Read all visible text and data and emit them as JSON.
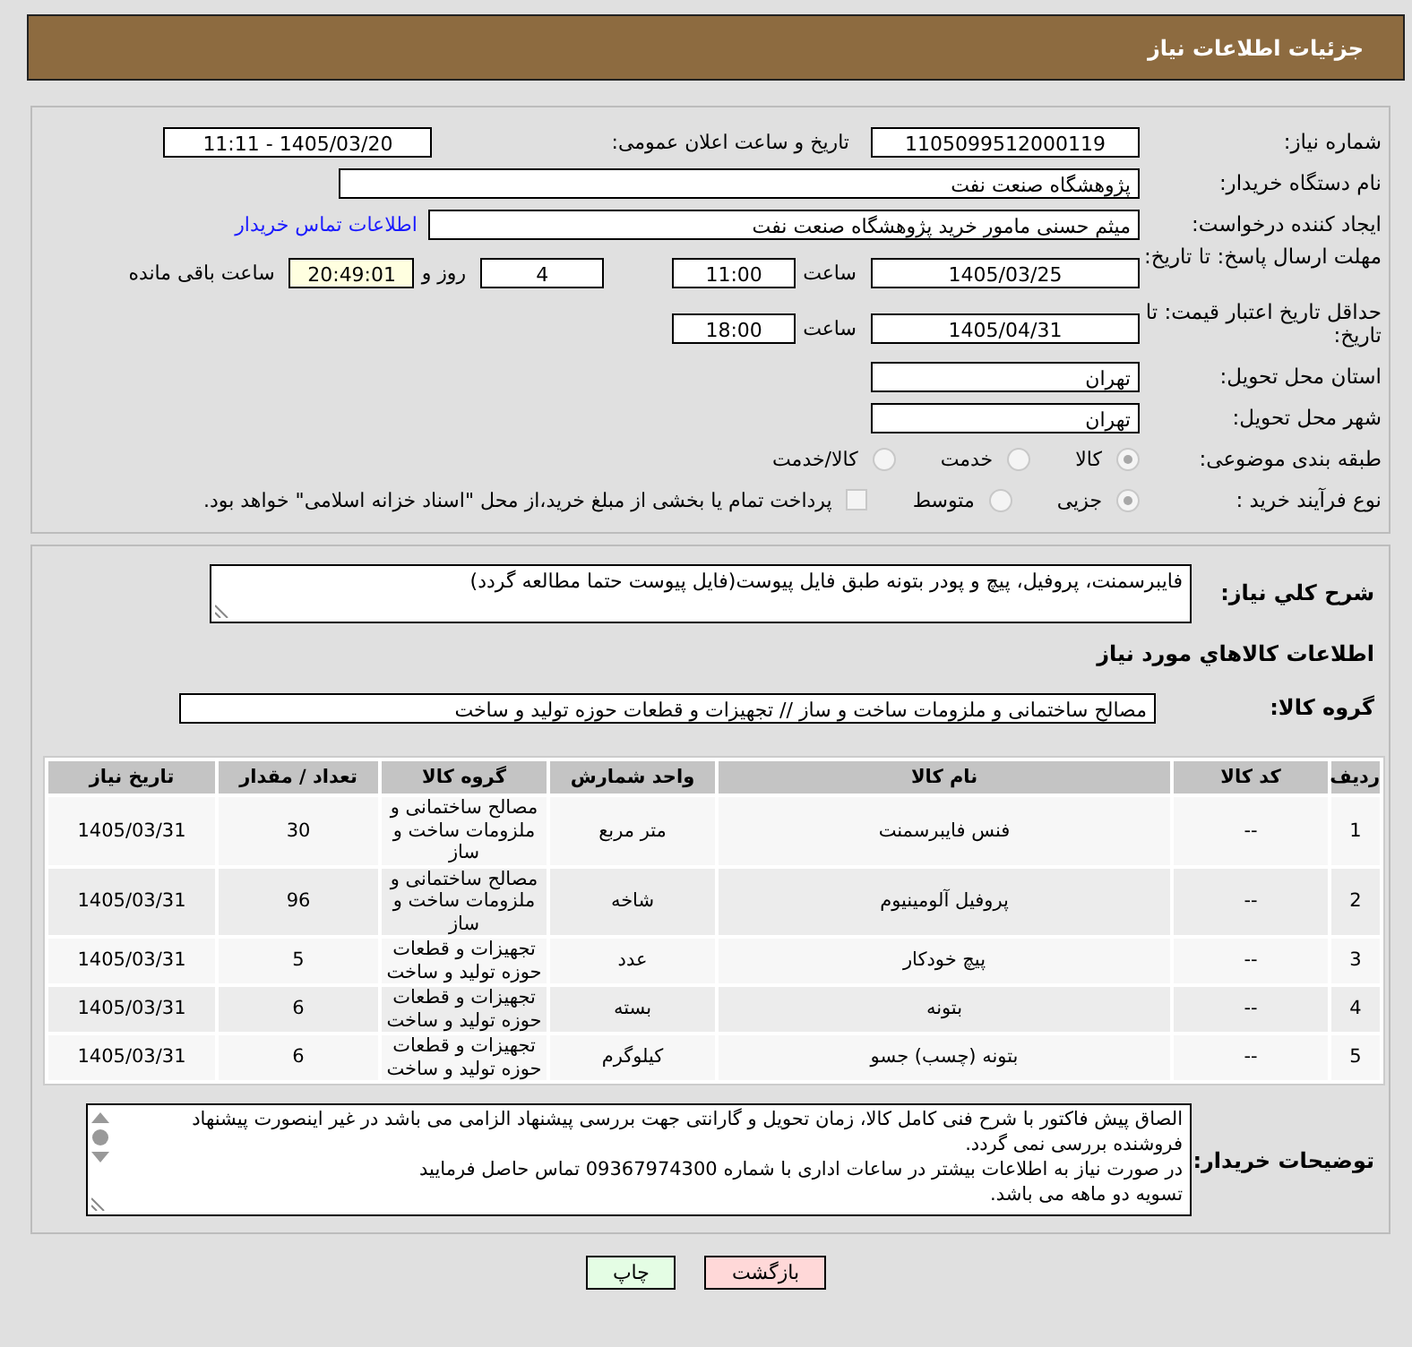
{
  "header": {
    "title": "جزئیات اطلاعات نیاز"
  },
  "form": {
    "need_number": {
      "label": "شماره نیاز:",
      "value": "1105099512000119"
    },
    "announce": {
      "label": "تاریخ و ساعت اعلان عمومی:",
      "value": "1405/03/20 - 11:11"
    },
    "buyer": {
      "label": "نام دستگاه خریدار:",
      "value": "پژوهشگاه صنعت نفت"
    },
    "requester": {
      "label": "ایجاد کننده درخواست:",
      "value": "میثم حسنی مامور خرید پژوهشگاه صنعت نفت",
      "link": "اطلاعات تماس خریدار"
    },
    "deadline": {
      "label": "مهلت ارسال پاسخ: تا تاریخ:",
      "date": "1405/03/25",
      "time_label": "ساعت",
      "time": "11:00",
      "days": "4",
      "days_label": "روز و",
      "remaining": "20:49:01",
      "remaining_label": "ساعت باقی مانده"
    },
    "validity": {
      "label": "حداقل تاریخ اعتبار قیمت: تا تاریخ:",
      "date": "1405/04/31",
      "time_label": "ساعت",
      "time": "18:00"
    },
    "province": {
      "label": "استان محل تحویل:",
      "value": "تهران"
    },
    "city": {
      "label": "شهر محل تحویل:",
      "value": "تهران"
    },
    "category": {
      "label": "طبقه بندی موضوعی:",
      "options": [
        {
          "label": "کالا",
          "selected": true
        },
        {
          "label": "خدمت",
          "selected": false
        },
        {
          "label": "کالا/خدمت",
          "selected": false
        }
      ]
    },
    "process": {
      "label": "نوع فرآیند خرید :",
      "options": [
        {
          "label": "جزیی",
          "selected": true
        },
        {
          "label": "متوسط",
          "selected": false
        }
      ],
      "payment": {
        "checked": false,
        "label": "پرداخت تمام یا بخشی از مبلغ خرید،از محل \"اسناد خزانه اسلامی\" خواهد بود."
      }
    }
  },
  "description": {
    "label": "شرح کلي نياز:",
    "value": "فایبرسمنت، پروفیل، پیچ و پودر بتونه طبق فایل پیوست(فایل پیوست حتما مطالعه گردد)"
  },
  "items_title": "اطلاعات کالاهاي مورد نياز",
  "goods_group": {
    "label": "گروه کالا:",
    "value": "مصالح ساختمانی و ملزومات ساخت و ساز // تجهیزات و قطعات حوزه تولید و ساخت"
  },
  "table": {
    "columns": [
      "ردیف",
      "کد کالا",
      "نام کالا",
      "واحد شمارش",
      "گروه کالا",
      "تعداد / مقدار",
      "تاریخ نیاز"
    ],
    "rows": [
      [
        "1",
        "--",
        "فنس فایبرسمنت",
        "متر مربع",
        "مصالح ساختمانی و ملزومات ساخت و ساز",
        "30",
        "1405/03/31"
      ],
      [
        "2",
        "--",
        "پروفیل آلومینیوم",
        "شاخه",
        "مصالح ساختمانی و ملزومات ساخت و ساز",
        "96",
        "1405/03/31"
      ],
      [
        "3",
        "--",
        "پیچ خودکار",
        "عدد",
        "تجهیزات و قطعات حوزه تولید و ساخت",
        "5",
        "1405/03/31"
      ],
      [
        "4",
        "--",
        "بتونه",
        "بسته",
        "تجهیزات و قطعات حوزه تولید و ساخت",
        "6",
        "1405/03/31"
      ],
      [
        "5",
        "--",
        "بتونه (چسب) جسو",
        "کیلوگرم",
        "تجهیزات و قطعات حوزه تولید و ساخت",
        "6",
        "1405/03/31"
      ]
    ]
  },
  "notes": {
    "label": "توضیحات خریدار:",
    "value": "الصاق پیش فاکتور با شرح فنی کامل کالا، زمان تحویل و گارانتی جهت بررسی پیشنهاد الزامی می باشد در غیر اینصورت پیشنهاد فروشنده بررسی نمی گردد.\nدر صورت نیاز به اطلاعات بیشتر در ساعات اداری با شماره 09367974300 تماس حاصل فرمایید\nتسویه دو ماهه می باشد."
  },
  "buttons": [
    {
      "kind": "back",
      "label": "بازگشت"
    },
    {
      "kind": "print",
      "label": "چاپ"
    }
  ]
}
